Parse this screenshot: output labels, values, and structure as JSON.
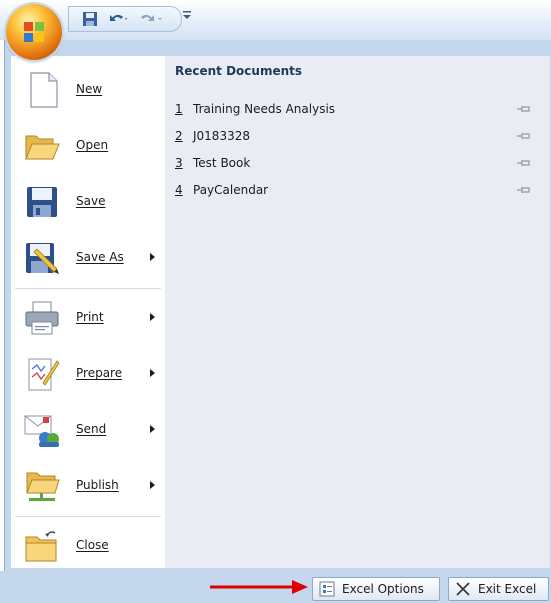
{
  "quick_access": {
    "buttons": [
      "save-icon",
      "undo-icon",
      "redo-icon",
      "customize-dropdown-icon"
    ]
  },
  "menu": {
    "items": [
      {
        "label": "New",
        "icon": "new-document-icon",
        "submenu": false
      },
      {
        "label": "Open",
        "icon": "open-folder-icon",
        "submenu": false
      },
      {
        "label": "Save",
        "icon": "save-disk-icon",
        "submenu": false
      },
      {
        "label": "Save As",
        "icon": "save-as-icon",
        "submenu": true
      },
      {
        "label": "Print",
        "icon": "printer-icon",
        "submenu": true
      },
      {
        "label": "Prepare",
        "icon": "prepare-icon",
        "submenu": true
      },
      {
        "label": "Send",
        "icon": "send-icon",
        "submenu": true
      },
      {
        "label": "Publish",
        "icon": "publish-icon",
        "submenu": true
      },
      {
        "label": "Close",
        "icon": "close-folder-icon",
        "submenu": false
      }
    ]
  },
  "recent": {
    "title": "Recent Documents",
    "items": [
      {
        "num": "1",
        "name": "Training Needs Analysis"
      },
      {
        "num": "2",
        "name": "J0183328"
      },
      {
        "num": "3",
        "name": "Test Book"
      },
      {
        "num": "4",
        "name": "PayCalendar"
      }
    ]
  },
  "footer": {
    "options_label": "Excel Options",
    "exit_label": "Exit Excel"
  },
  "colors": {
    "accent": "#c5d7ed",
    "annotation_arrow": "#e00000"
  }
}
